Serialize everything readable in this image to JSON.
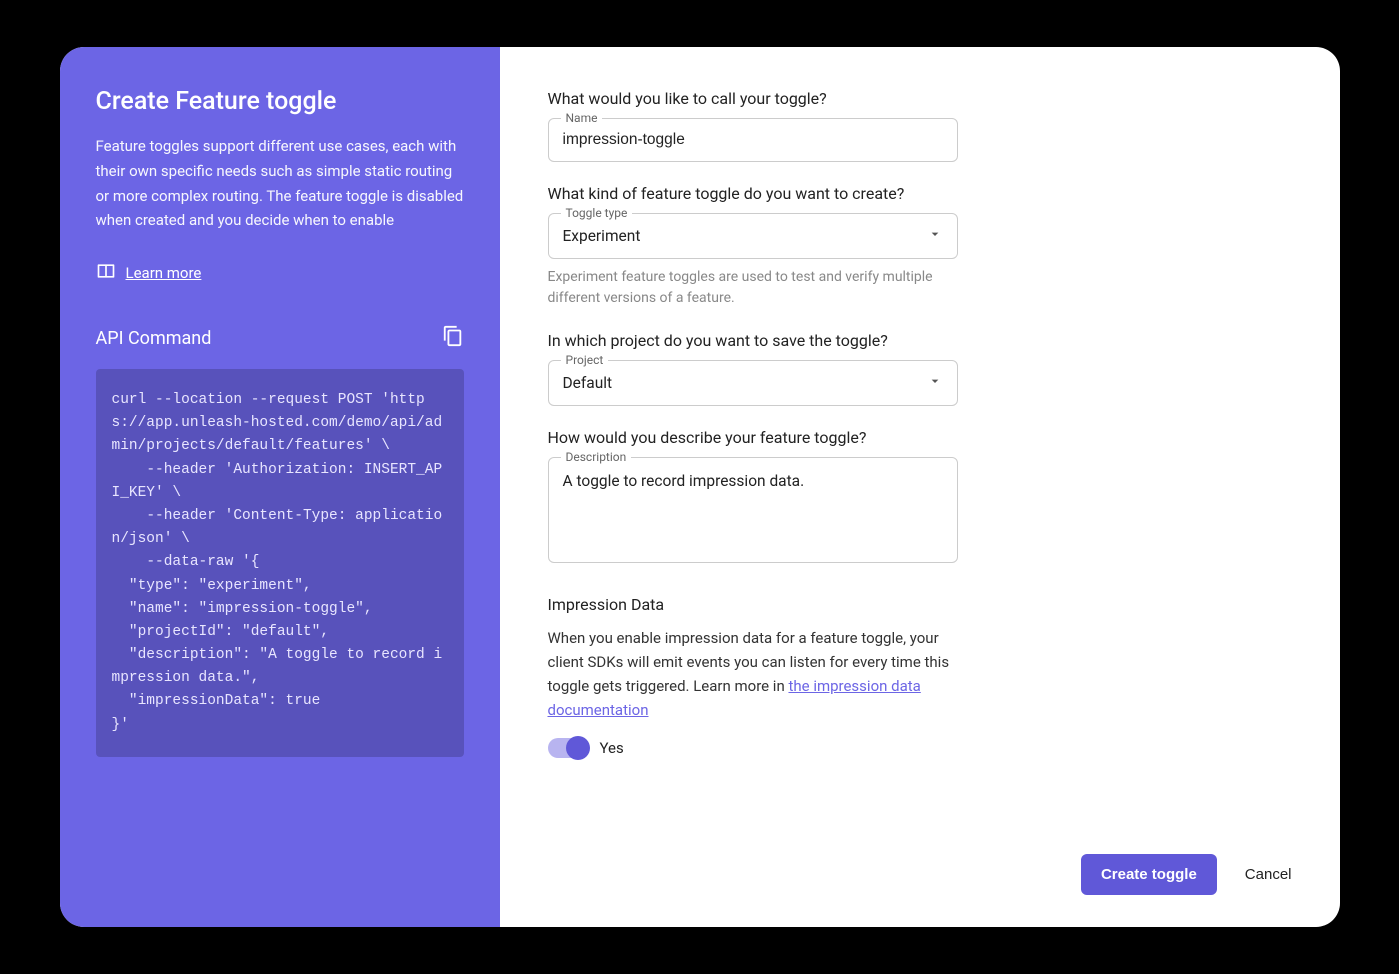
{
  "sidebar": {
    "title": "Create Feature toggle",
    "description": "Feature toggles support different use cases, each with their own specific needs such as simple static routing or more complex routing. The feature toggle is disabled when created and you decide when to enable",
    "learn_more": "Learn more",
    "api_command_label": "API Command",
    "code": "curl --location --request POST 'https://app.unleash-hosted.com/demo/api/admin/projects/default/features' \\\n    --header 'Authorization: INSERT_API_KEY' \\\n    --header 'Content-Type: application/json' \\\n    --data-raw '{\n  \"type\": \"experiment\",\n  \"name\": \"impression-toggle\",\n  \"projectId\": \"default\",\n  \"description\": \"A toggle to record impression data.\",\n  \"impressionData\": true\n}'"
  },
  "form": {
    "name": {
      "question": "What would you like to call your toggle?",
      "label": "Name",
      "value": "impression-toggle"
    },
    "type": {
      "question": "What kind of feature toggle do you want to create?",
      "label": "Toggle type",
      "value": "Experiment",
      "help": "Experiment feature toggles are used to test and verify multiple different versions of a feature."
    },
    "project": {
      "question": "In which project do you want to save the toggle?",
      "label": "Project",
      "value": "Default"
    },
    "description": {
      "question": "How would you describe your feature toggle?",
      "label": "Description",
      "value": "A toggle to record impression data."
    },
    "impression": {
      "title": "Impression Data",
      "desc_prefix": "When you enable impression data for a feature toggle, your client SDKs will emit events you can listen for every time this toggle gets triggered. Learn more in ",
      "doc_link": "the impression data documentation",
      "switch_label": "Yes"
    }
  },
  "footer": {
    "create": "Create toggle",
    "cancel": "Cancel"
  }
}
